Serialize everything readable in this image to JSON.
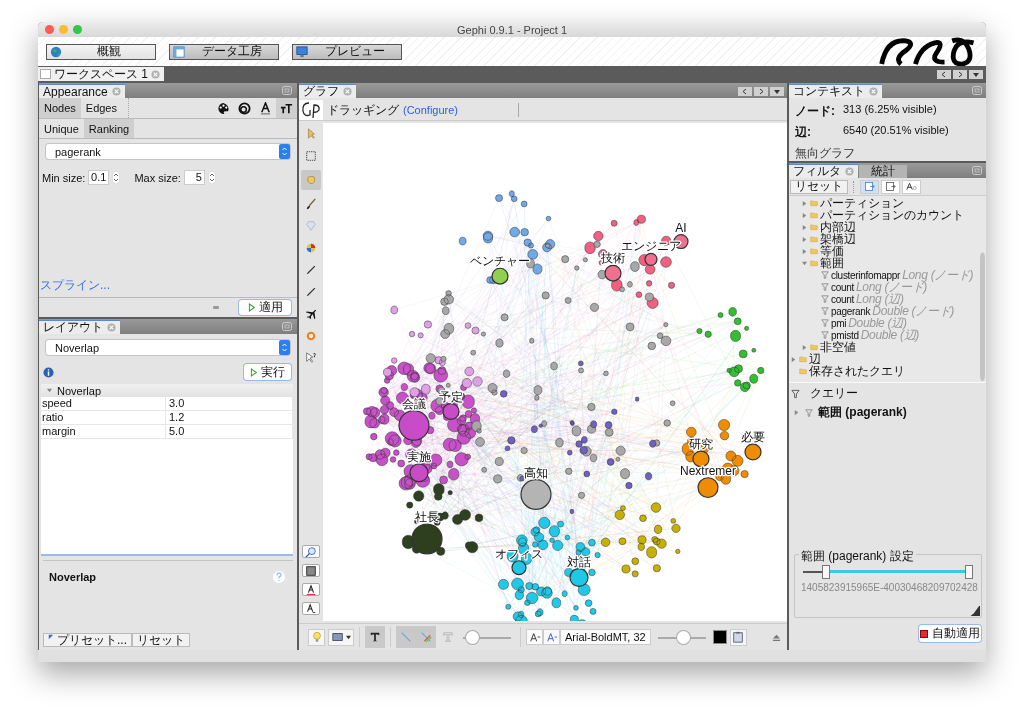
{
  "window": {
    "title": "Gephi 0.9.1 - Project 1"
  },
  "main_buttons": [
    {
      "label": "概観",
      "kind": "globe",
      "selected": true
    },
    {
      "label": "データ工房",
      "kind": "table",
      "selected": false
    },
    {
      "label": "プレビュー",
      "kind": "monitor",
      "selected": false
    }
  ],
  "workspace_tab": {
    "label": "ワークスペース 1"
  },
  "appearance": {
    "title": "Appearance",
    "element_tabs": [
      {
        "label": "Nodes",
        "selected": true
      },
      {
        "label": "Edges",
        "selected": false
      }
    ],
    "transform_tabs": [
      {
        "kind": "color",
        "selected": false
      },
      {
        "kind": "size",
        "selected": false
      },
      {
        "kind": "label_color",
        "selected": false
      },
      {
        "kind": "label_size",
        "selected": true
      }
    ],
    "mode_tabs": [
      {
        "label": "Unique",
        "selected": false
      },
      {
        "label": "Ranking",
        "selected": true
      }
    ],
    "attribute": "pagerank",
    "min_label": "Min size:",
    "min_value": "0.1",
    "max_label": "Max size:",
    "max_value": "5",
    "spline_link": "スプライン...",
    "apply_button": "適用"
  },
  "layout": {
    "title": "レイアウト",
    "algorithm": "Noverlap",
    "run_button": "実行",
    "section": "Noverlap",
    "properties": [
      {
        "name": "speed",
        "value": "3.0"
      },
      {
        "name": "ratio",
        "value": "1.2"
      },
      {
        "name": "margin",
        "value": "5.0"
      }
    ],
    "description_title": "Noverlap",
    "preset_button": "プリセット...",
    "reset_button": "リセット"
  },
  "graph": {
    "title": "グラフ",
    "mode": "ドラッギング",
    "configure_link": "(Configure)",
    "tools": [
      {
        "kind": "pointer",
        "selected": false
      },
      {
        "kind": "rect",
        "selected": false
      },
      {
        "kind": "hand",
        "selected": true
      },
      {
        "kind": "brush",
        "selected": false
      },
      {
        "kind": "diamond",
        "selected": false
      },
      {
        "kind": "wheel",
        "selected": false
      },
      {
        "kind": "pencil",
        "selected": false
      },
      {
        "kind": "pencil",
        "selected": false
      },
      {
        "kind": "plane",
        "selected": false
      },
      {
        "kind": "flower",
        "selected": false
      },
      {
        "kind": "help",
        "selected": false
      }
    ],
    "nodes": [
      {
        "label": "高知",
        "color": "#b4b4b4"
      },
      {
        "label": "Nextremer",
        "color": "#f08c00"
      },
      {
        "label": "社長",
        "color": "#2d3f1c"
      },
      {
        "label": "対話",
        "color": "#1ec8e6"
      },
      {
        "label": "オフィス",
        "color": "#1ec8e6"
      },
      {
        "label": "会議",
        "color": "#c84cc8"
      },
      {
        "label": "予定",
        "color": "#c84cc8"
      },
      {
        "label": "実施",
        "color": "#c84cc8"
      },
      {
        "label": "研究",
        "color": "#f08c00"
      },
      {
        "label": "必要",
        "color": "#f08c00"
      },
      {
        "label": "ベンチャー",
        "color": "#8fd050"
      },
      {
        "label": "エンジニア",
        "color": "#f07090"
      },
      {
        "label": "技術",
        "color": "#f07090"
      },
      {
        "label": "AI",
        "color": "#f07090"
      }
    ],
    "edge_scale": {
      "level": 0.05
    },
    "label_font": "Arial-BoldMT, 32",
    "label_scale": {
      "level": 0.55
    }
  },
  "context": {
    "title": "コンテキスト",
    "rows": [
      {
        "label": "ノード:",
        "value": "313 (6.25% visible)"
      },
      {
        "label": "辺:",
        "value": "6540 (20.51% visible)"
      }
    ],
    "graph_type": "無向グラフ"
  },
  "filters": {
    "tabs": [
      {
        "label": "フィルタ",
        "selected": true
      },
      {
        "label": "統計",
        "selected": false
      }
    ],
    "reset_button": "リセット",
    "tree": [
      {
        "children": [
          {
            "kind": "folder",
            "label": "パーティション",
            "toggle": true,
            "expanded": false
          },
          {
            "kind": "folder",
            "label": "パーティションのカウント",
            "toggle": true,
            "expanded": false
          },
          {
            "kind": "folder",
            "label": "内部辺",
            "toggle": true,
            "expanded": false
          },
          {
            "kind": "folder",
            "label": "架橋辺",
            "toggle": true,
            "expanded": false
          },
          {
            "kind": "folder",
            "label": "等価",
            "toggle": true,
            "expanded": false
          },
          {
            "kind": "folder",
            "label": "範囲",
            "toggle": true,
            "expanded": true,
            "children": [
              {
                "kind": "filter",
                "label": "clusterinfomappr",
                "type": "Long (ノード)"
              },
              {
                "kind": "filter",
                "label": "count",
                "type": "Long (ノード)"
              },
              {
                "kind": "filter",
                "label": "count",
                "type": "Long (辺)"
              },
              {
                "kind": "filter",
                "label": "pagerank",
                "type": "Double (ノード)"
              },
              {
                "kind": "filter",
                "label": "pmi",
                "type": "Double (辺)"
              },
              {
                "kind": "filter",
                "label": "pmistd",
                "type": "Double (辺)"
              }
            ]
          },
          {
            "kind": "folder",
            "label": "非空値",
            "toggle": true,
            "expanded": false
          }
        ]
      },
      {
        "kind": "folder",
        "label": "辺",
        "toggle": true,
        "expanded": false
      },
      {
        "kind": "folder",
        "label": "保存されたクエリ",
        "toggle": false
      }
    ],
    "query_title": "クエリー",
    "queries": [
      {
        "label": "範囲 (pagerank)",
        "expanded": false
      }
    ],
    "settings_title": "範囲 (pagerank) 設定",
    "low_thumb": {
      "level": 0.12
    },
    "high_thumb": {
      "level": 1.0
    },
    "range_value": "1405823915965E-40030468209702428",
    "auto_apply_button": "自動適用"
  }
}
